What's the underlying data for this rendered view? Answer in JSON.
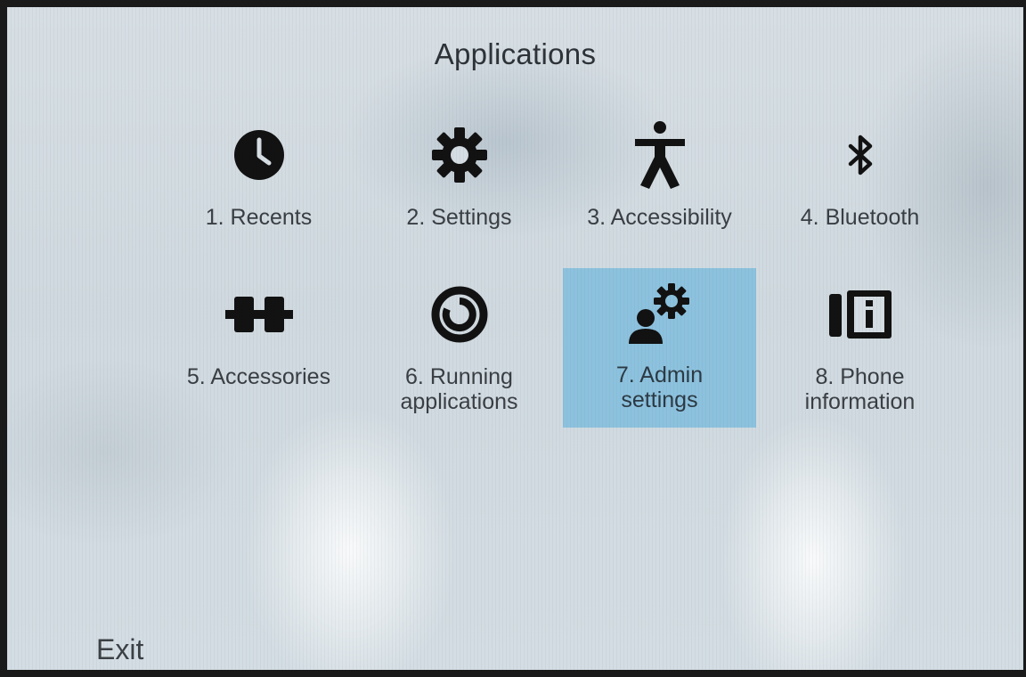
{
  "screen": {
    "title": "Applications",
    "exit_label": "Exit"
  },
  "apps": [
    {
      "label": "1. Recents",
      "icon": "clock-icon"
    },
    {
      "label": "2. Settings",
      "icon": "gear-icon"
    },
    {
      "label": "3. Accessibility",
      "icon": "accessibility-person-icon"
    },
    {
      "label": "4. Bluetooth",
      "icon": "bluetooth-icon"
    },
    {
      "label": "5. Accessories",
      "icon": "accessories-connector-icon"
    },
    {
      "label": "6. Running\napplications",
      "icon": "running-applications-icon"
    },
    {
      "label": "7. Admin\nsettings",
      "icon": "admin-settings-icon",
      "selected": true
    },
    {
      "label": "8. Phone\ninformation",
      "icon": "phone-information-icon"
    }
  ],
  "colors": {
    "selected_tile": "#8dc2de",
    "icon": "#121212",
    "text": "#3a3f44"
  }
}
